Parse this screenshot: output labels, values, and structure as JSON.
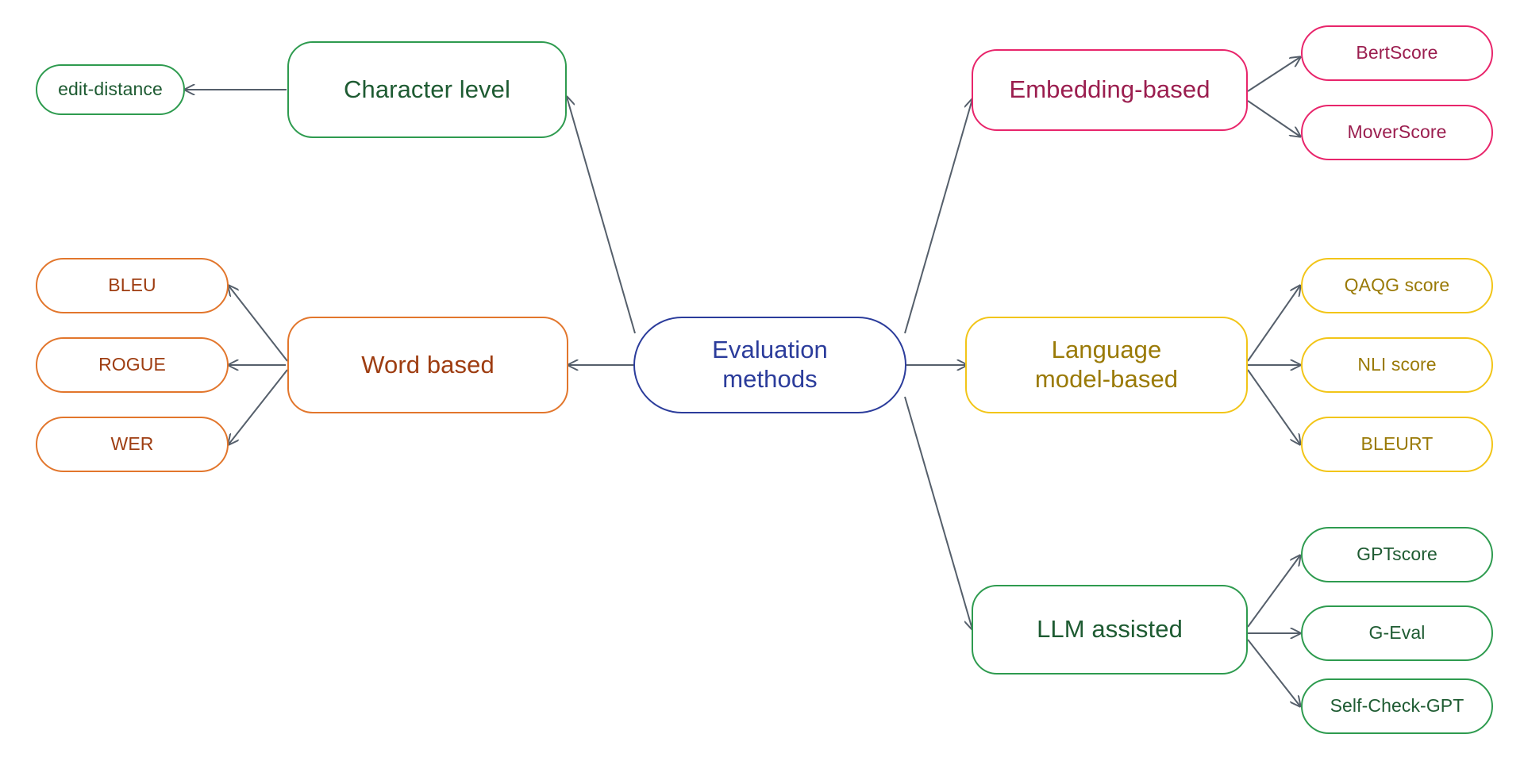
{
  "diagram": {
    "title": "Evaluation methods",
    "type": "mindmap",
    "background": "#ffffff",
    "edge_color": "#555f6b"
  },
  "palette": {
    "green_border": "#2E9B4F",
    "green_text": "#1E5B32",
    "orange_border": "#E2762C",
    "orange_text": "#9E3D11",
    "blue_border": "#2B3C9B",
    "blue_text": "#2B3C9B",
    "pink_border": "#E8256B",
    "pink_text": "#9B1E4F",
    "yellow_border": "#F2C518",
    "yellow_text": "#9A7A07"
  },
  "root": {
    "label": "Evaluation\nmethods"
  },
  "branches": [
    {
      "id": "character-level",
      "label": "Character level",
      "color": "green",
      "children": [
        {
          "id": "edit-distance",
          "label": "edit-distance"
        }
      ]
    },
    {
      "id": "word-based",
      "label": "Word based",
      "color": "orange",
      "children": [
        {
          "id": "bleu",
          "label": "BLEU"
        },
        {
          "id": "rogue",
          "label": "ROGUE"
        },
        {
          "id": "wer",
          "label": "WER"
        }
      ]
    },
    {
      "id": "embedding-based",
      "label": "Embedding-based",
      "color": "pink",
      "children": [
        {
          "id": "bertscore",
          "label": "BertScore"
        },
        {
          "id": "moverscore",
          "label": "MoverScore"
        }
      ]
    },
    {
      "id": "language-model-based",
      "label": "Language\nmodel-based",
      "color": "yellow",
      "children": [
        {
          "id": "qaqg-score",
          "label": "QAQG score"
        },
        {
          "id": "nli-score",
          "label": "NLI score"
        },
        {
          "id": "bleurt",
          "label": "BLEURT"
        }
      ]
    },
    {
      "id": "llm-assisted",
      "label": "LLM assisted",
      "color": "green",
      "children": [
        {
          "id": "gptscore",
          "label": "GPTscore"
        },
        {
          "id": "g-eval",
          "label": "G-Eval"
        },
        {
          "id": "self-check-gpt",
          "label": "Self-Check-GPT"
        }
      ]
    }
  ]
}
